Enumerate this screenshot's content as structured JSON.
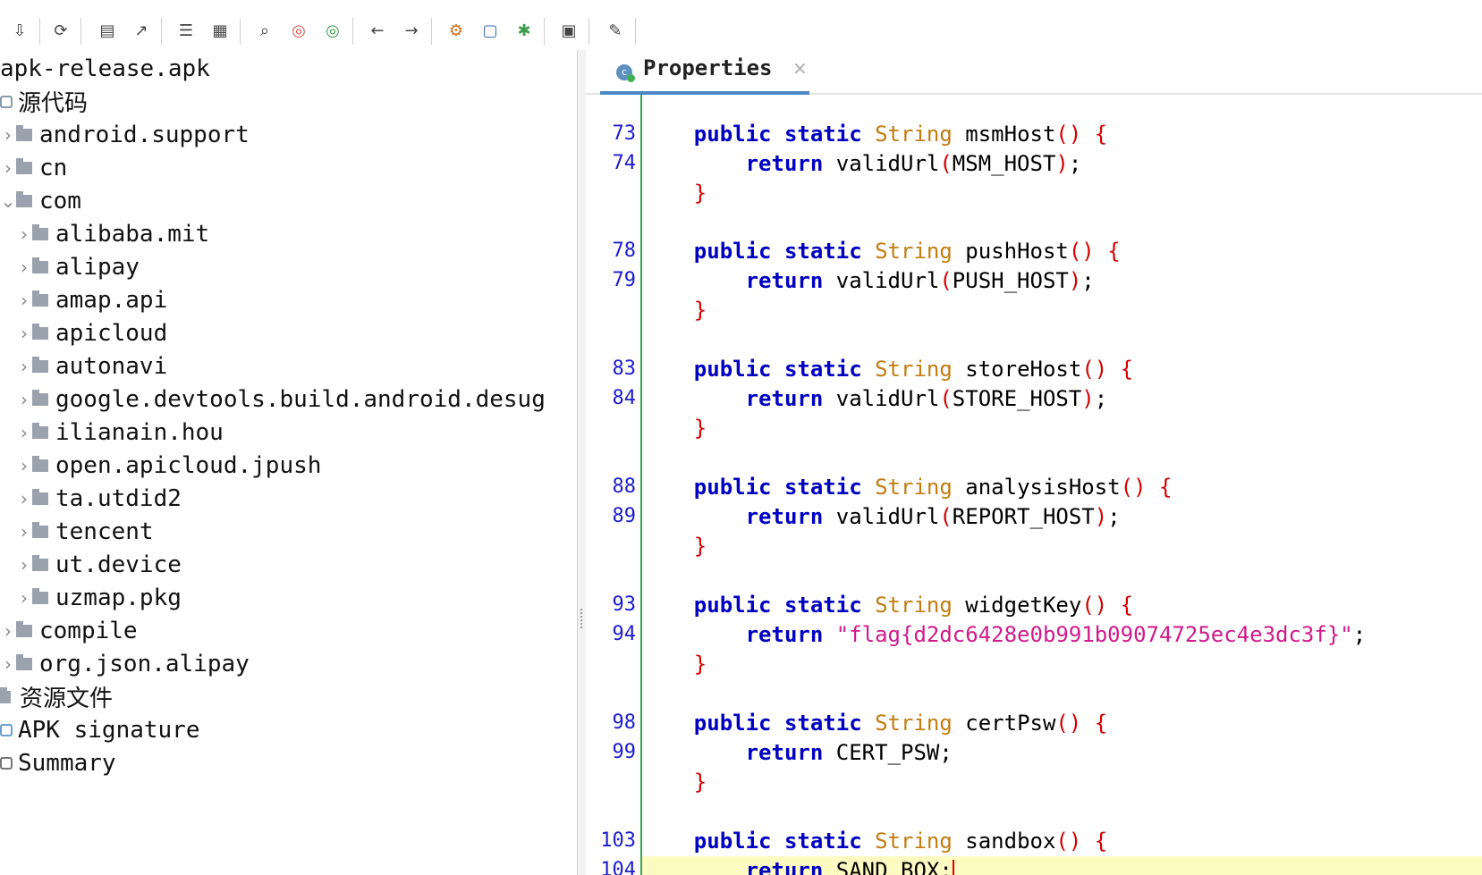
{
  "toolbar": {
    "icons": [
      "export-icon",
      "sync-icon",
      "save-icon",
      "open-external-icon",
      "align-icon",
      "tree-icon",
      "search-icon",
      "find-class-icon",
      "find-usage-icon",
      "back-icon",
      "forward-icon",
      "decompile-icon",
      "bookmark-icon",
      "debug-icon",
      "log-icon",
      "settings-icon"
    ]
  },
  "tree": {
    "root": "apk-release.apk",
    "source_label": "源代码",
    "items": [
      {
        "label": "android.support"
      },
      {
        "label": "cn"
      },
      {
        "label": "com"
      },
      {
        "label": "alibaba.mit"
      },
      {
        "label": "alipay"
      },
      {
        "label": "amap.api"
      },
      {
        "label": "apicloud"
      },
      {
        "label": "autonavi"
      },
      {
        "label": "google.devtools.build.android.desug"
      },
      {
        "label": "ilianain.hou"
      },
      {
        "label": "open.apicloud.jpush"
      },
      {
        "label": "ta.utdid2"
      },
      {
        "label": "tencent"
      },
      {
        "label": "ut.device"
      },
      {
        "label": "uzmap.pkg"
      },
      {
        "label": "compile"
      },
      {
        "label": "org.json.alipay"
      }
    ],
    "resources_label": "资源文件",
    "apk_signature_label": "APK signature",
    "summary_label": "Summary"
  },
  "editor": {
    "tab_label": "Properties",
    "tab_close": "×",
    "lines": [
      {
        "num": "73",
        "kw1": "public",
        "kw2": "static",
        "type": "String",
        "name": "msmHost",
        "open": "()",
        "brace": "{"
      },
      {
        "num": "74",
        "ret": "return",
        "call": "validUrl",
        "arg": "MSM_HOST",
        "end": ";"
      },
      {
        "close": "}"
      },
      {
        "num": "78",
        "kw1": "public",
        "kw2": "static",
        "type": "String",
        "name": "pushHost",
        "open": "()",
        "brace": "{"
      },
      {
        "num": "79",
        "ret": "return",
        "call": "validUrl",
        "arg": "PUSH_HOST",
        "end": ";"
      },
      {
        "close": "}"
      },
      {
        "num": "83",
        "kw1": "public",
        "kw2": "static",
        "type": "String",
        "name": "storeHost",
        "open": "()",
        "brace": "{"
      },
      {
        "num": "84",
        "ret": "return",
        "call": "validUrl",
        "arg": "STORE_HOST",
        "end": ";"
      },
      {
        "close": "}"
      },
      {
        "num": "88",
        "kw1": "public",
        "kw2": "static",
        "type": "String",
        "name": "analysisHost",
        "open": "()",
        "brace": "{"
      },
      {
        "num": "89",
        "ret": "return",
        "call": "validUrl",
        "arg": "REPORT_HOST",
        "end": ";"
      },
      {
        "close": "}"
      },
      {
        "num": "93",
        "kw1": "public",
        "kw2": "static",
        "type": "String",
        "name": "widgetKey",
        "open": "()",
        "brace": "{"
      },
      {
        "num": "94",
        "ret": "return",
        "string": "\"flag{d2dc6428e0b991b09074725ec4e3dc3f}\"",
        "end": ";"
      },
      {
        "close": "}"
      },
      {
        "num": "98",
        "kw1": "public",
        "kw2": "static",
        "type": "String",
        "name": "certPsw",
        "open": "()",
        "brace": "{"
      },
      {
        "num": "99",
        "ret": "return",
        "plain": "CERT_PSW",
        "end": ";"
      },
      {
        "close": "}"
      },
      {
        "num": "103",
        "kw1": "public",
        "kw2": "static",
        "type": "String",
        "name": "sandbox",
        "open": "()",
        "brace": "{"
      },
      {
        "num": "104",
        "ret": "return",
        "plain": "SAND_BOX",
        "end": ";"
      }
    ]
  },
  "colors": {
    "keyword": "#0000c0",
    "type": "#c27d12",
    "paren": "#d40000",
    "string": "#d01a8a",
    "line_number": "#1c1ccc",
    "gutter_border": "#2fa84f",
    "current_line": "#fdfbc2",
    "tab_underline": "#4a88c7"
  }
}
